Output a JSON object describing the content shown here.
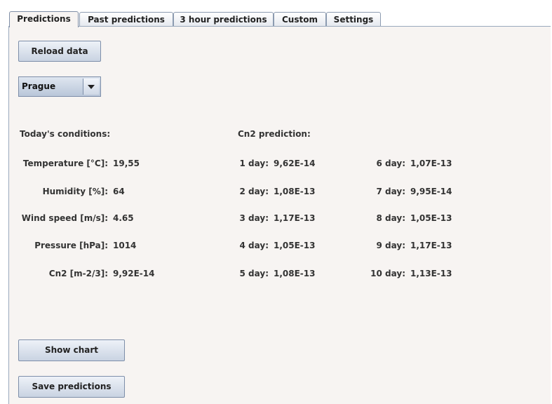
{
  "tabs": [
    {
      "label": "Predictions",
      "active": true
    },
    {
      "label": "Past predictions",
      "active": false
    },
    {
      "label": "3 hour predictions",
      "active": false
    },
    {
      "label": "Custom",
      "active": false
    },
    {
      "label": "Settings",
      "active": false
    }
  ],
  "buttons": {
    "reload": "Reload data",
    "show_chart": "Show chart",
    "save": "Save predictions"
  },
  "city_select": {
    "value": "Prague"
  },
  "conditions": {
    "heading": "Today's conditions:",
    "rows": [
      {
        "label": "Temperature [°C]:",
        "value": "19,55"
      },
      {
        "label": "Humidity [%]:",
        "value": "64"
      },
      {
        "label": "Wind speed [m/s]:",
        "value": "4.65"
      },
      {
        "label": "Pressure [hPa]:",
        "value": "1014"
      },
      {
        "label": "Cn2 [m-2/3]:",
        "value": "9,92E-14"
      }
    ]
  },
  "prediction": {
    "heading": "Cn2 prediction:",
    "left": [
      {
        "label": "1 day:",
        "value": "9,62E-14"
      },
      {
        "label": "2 day:",
        "value": "1,08E-13"
      },
      {
        "label": "3 day:",
        "value": "1,17E-13"
      },
      {
        "label": "4 day:",
        "value": "1,05E-13"
      },
      {
        "label": "5 day:",
        "value": "1,08E-13"
      }
    ],
    "right": [
      {
        "label": "6 day:",
        "value": "1,07E-13"
      },
      {
        "label": "7 day:",
        "value": "9,95E-14"
      },
      {
        "label": "8 day:",
        "value": "1,05E-13"
      },
      {
        "label": "9 day:",
        "value": "1,17E-13"
      },
      {
        "label": "10 day:",
        "value": "1,13E-13"
      }
    ]
  }
}
